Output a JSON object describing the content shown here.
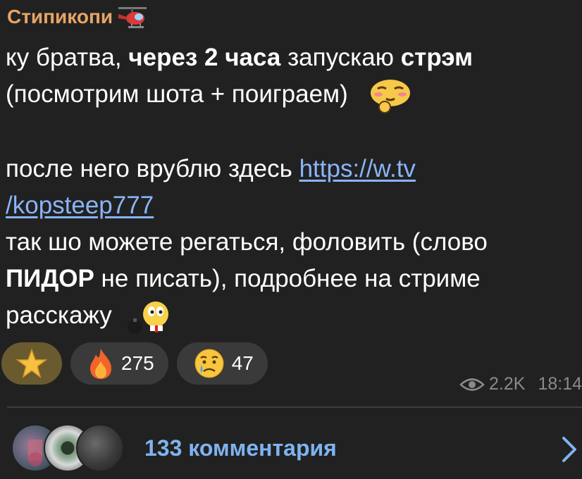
{
  "channel": {
    "author_name": "Стипикопи",
    "author_icon": "helicopter-icon"
  },
  "message": {
    "p1_a": "ку братва, ",
    "p1_b": "через 2 часа",
    "p1_c": " запускаю ",
    "p1_d": "стрэм",
    "p1_e": "(посмотрим шота + поиграем)",
    "p2_a": "после него врублю здесь ",
    "link_line1": "https://w.tv",
    "link_line2": "/kopsteep777",
    "p3_a": "так шо можете регаться, фоловить (слово",
    "p3_b": "ПИДОР",
    "p3_c": " не писать), подробнее на стриме",
    "p3_d": "расскажу"
  },
  "reactions": [
    {
      "icon": "star-icon",
      "count": ""
    },
    {
      "icon": "fire-icon",
      "count": "275"
    },
    {
      "icon": "crying-face-icon",
      "count": "47"
    }
  ],
  "meta": {
    "views": "2.2K",
    "time": "18:14"
  },
  "comments": {
    "label": "133 комментария"
  },
  "colors": {
    "background": "#212121",
    "author": "#e6a565",
    "link": "#8ab4f8",
    "comments": "#7fb3f0",
    "muted": "#8a8a8a"
  }
}
